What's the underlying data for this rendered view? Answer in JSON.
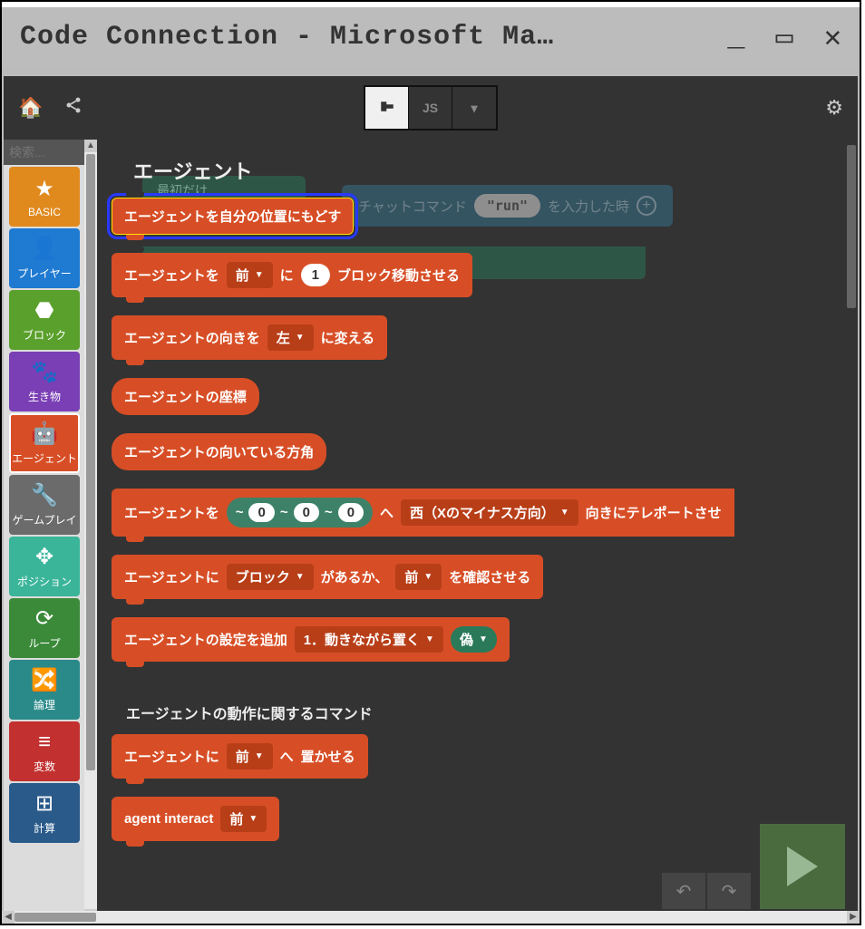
{
  "window": {
    "title": "Code Connection - Microsoft Ma…"
  },
  "toolbar": {
    "js_label": "JS"
  },
  "search": {
    "placeholder": "検索..."
  },
  "categories": [
    {
      "id": "basic",
      "label": "BASIC",
      "color": "#e08a1e",
      "icon": "★"
    },
    {
      "id": "player",
      "label": "プレイヤー",
      "color": "#1f7ad1",
      "icon": "👤"
    },
    {
      "id": "block",
      "label": "ブロック",
      "color": "#5aa02c",
      "icon": "⬣"
    },
    {
      "id": "mob",
      "label": "生き物",
      "color": "#7a3fb5",
      "icon": "🐾"
    },
    {
      "id": "agent",
      "label": "エージェント",
      "color": "#d74e26",
      "icon": "🤖",
      "selected": true
    },
    {
      "id": "gameplay",
      "label": "ゲームプレイ",
      "color": "#6b6b6b",
      "icon": "🔧"
    },
    {
      "id": "position",
      "label": "ポジション",
      "color": "#3bb59a",
      "icon": "✥"
    },
    {
      "id": "loop",
      "label": "ループ",
      "color": "#3a8a3a",
      "icon": "⟳"
    },
    {
      "id": "logic",
      "label": "論理",
      "color": "#2a8a8a",
      "icon": "🔀"
    },
    {
      "id": "variable",
      "label": "変数",
      "color": "#c23030",
      "icon": "≡"
    },
    {
      "id": "math",
      "label": "計算",
      "color": "#2a5a8a",
      "icon": "⊞"
    }
  ],
  "section": {
    "title": "エージェント",
    "subtitle": "エージェントの動作に関するコマンド"
  },
  "bg": {
    "first_only": "最初だけ",
    "chat_prefix": "チャットコマンド",
    "chat_cmd": "\"run\"",
    "chat_suffix": "を入力した時"
  },
  "blocks": {
    "teleport_self": "エージェントを自分の位置にもどす",
    "move": {
      "pre": "エージェントを",
      "dir": "前",
      "mid": "に",
      "count": "1",
      "post": "ブロック移動させる"
    },
    "turn": {
      "pre": "エージェントの向きを",
      "dir": "左",
      "post": "に変える"
    },
    "position": "エージェントの座標",
    "facing": "エージェントの向いている方角",
    "tp": {
      "pre": "エージェントを",
      "x": "0",
      "y": "0",
      "z": "0",
      "mid": "へ",
      "face": "西（Xのマイナス方向）",
      "post": "向きにテレポートさせ"
    },
    "detect": {
      "pre": "エージェントに",
      "what": "ブロック",
      "mid": "があるか、",
      "dir": "前",
      "post": "を確認させる"
    },
    "setting": {
      "pre": "エージェントの設定を追加",
      "opt": "1．動きながら置く",
      "val": "偽"
    },
    "place": {
      "pre": "エージェントに",
      "dir": "前",
      "mid": "へ",
      "post": "置かせる"
    },
    "interact": {
      "pre": "agent interact",
      "dir": "前"
    }
  }
}
